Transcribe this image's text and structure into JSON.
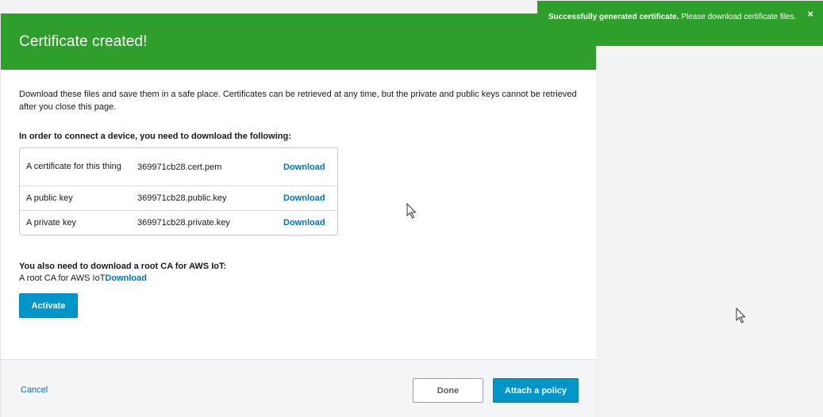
{
  "dialog": {
    "title": "Certificate created!",
    "intro": "Download these files and save them in a safe place. Certificates can be retrieved at any time, but the private and public keys cannot be retrieved after you close this page.",
    "files_heading": "In order to connect a device, you need to download the following:",
    "files": [
      {
        "label": "A certificate for this thing",
        "file": "369971cb28.cert.pem",
        "action": "Download"
      },
      {
        "label": "A public key",
        "file": "369971cb28.public.key",
        "action": "Download"
      },
      {
        "label": "A private key",
        "file": "369971cb28.private.key",
        "action": "Download"
      }
    ],
    "root_heading": "You also need to download a root CA for AWS IoT:",
    "root_label": "A root CA for AWS IoT",
    "root_action": "Download",
    "activate_label": "Activate"
  },
  "footer": {
    "cancel_label": "Cancel",
    "done_label": "Done",
    "attach_label": "Attach a policy"
  },
  "toast": {
    "bold_text": "Successfully generated certificate.",
    "text": " Please download certificate files.",
    "close_icon": "close-icon"
  },
  "colors": {
    "success_green": "#2d9f2a",
    "primary_blue": "#0096c9",
    "link_blue": "#0073bb"
  }
}
